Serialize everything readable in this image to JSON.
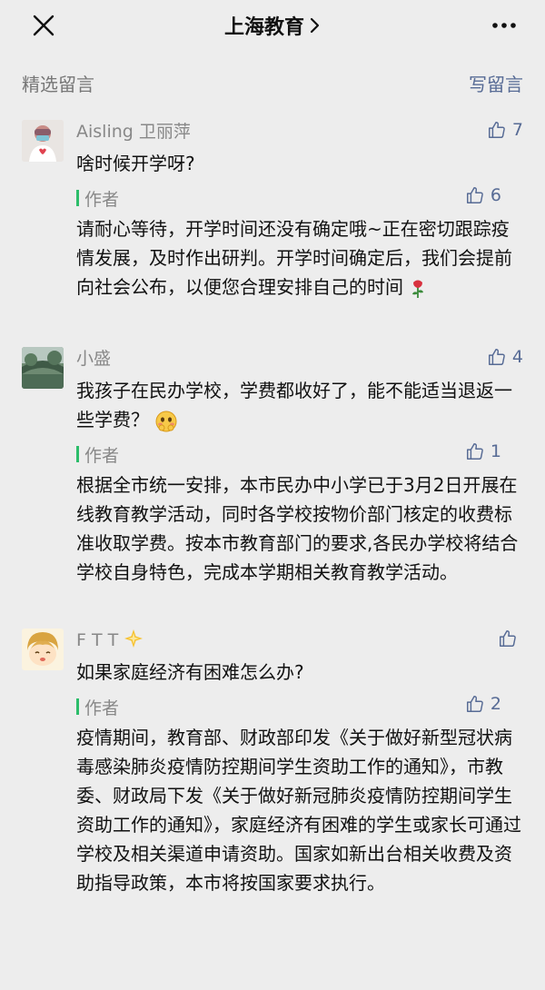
{
  "header": {
    "title": "上海教育"
  },
  "section": {
    "label": "精选留言",
    "write_label": "写留言"
  },
  "comments": [
    {
      "nickname": "Aisling 卫丽萍",
      "likes": "7",
      "text": "啥时候开学呀?",
      "reply": {
        "author_label": "作者",
        "likes": "6",
        "text": "请耐心等待，开学时间还没有确定哦~正在密切跟踪疫情发展，及时作出研判。开学时间确定后，我们会提前向社会公布，以便您合理安排自己的时间"
      }
    },
    {
      "nickname": "小盛",
      "likes": "4",
      "text": "我孩子在民办学校，学费都收好了，能不能适当退返一些学费？",
      "reply": {
        "author_label": "作者",
        "likes": "1",
        "text": "根据全市统一安排，本市民办中小学已于3月2日开展在线教育教学活动，同时各学校按物价部门核定的收费标准收取学费。按本市教育部门的要求,各民办学校将结合学校自身特色，完成本学期相关教育教学活动。"
      }
    },
    {
      "nickname": "F T T",
      "likes": "",
      "text": "如果家庭经济有困难怎么办?",
      "reply": {
        "author_label": "作者",
        "likes": "2",
        "text": "疫情期间，教育部、财政部印发《关于做好新型冠状病毒感染肺炎疫情防控期间学生资助工作的通知》，市教委、财政局下发《关于做好新冠肺炎疫情防控期间学生资助工作的通知》，家庭经济有困难的学生或家长可通过学校及相关渠道申请资助。国家如新出台相关收费及资助指导政策，本市将按国家要求执行。"
      }
    }
  ],
  "colors": {
    "link": "#576b95",
    "author_bar": "#2cbd6a",
    "background": "#ededed"
  },
  "icons": [
    "close-icon",
    "more-icon",
    "chevron-right-icon",
    "thumbs-up-icon",
    "rose-icon",
    "blush-emoji-icon",
    "sparkle-star-icon"
  ]
}
